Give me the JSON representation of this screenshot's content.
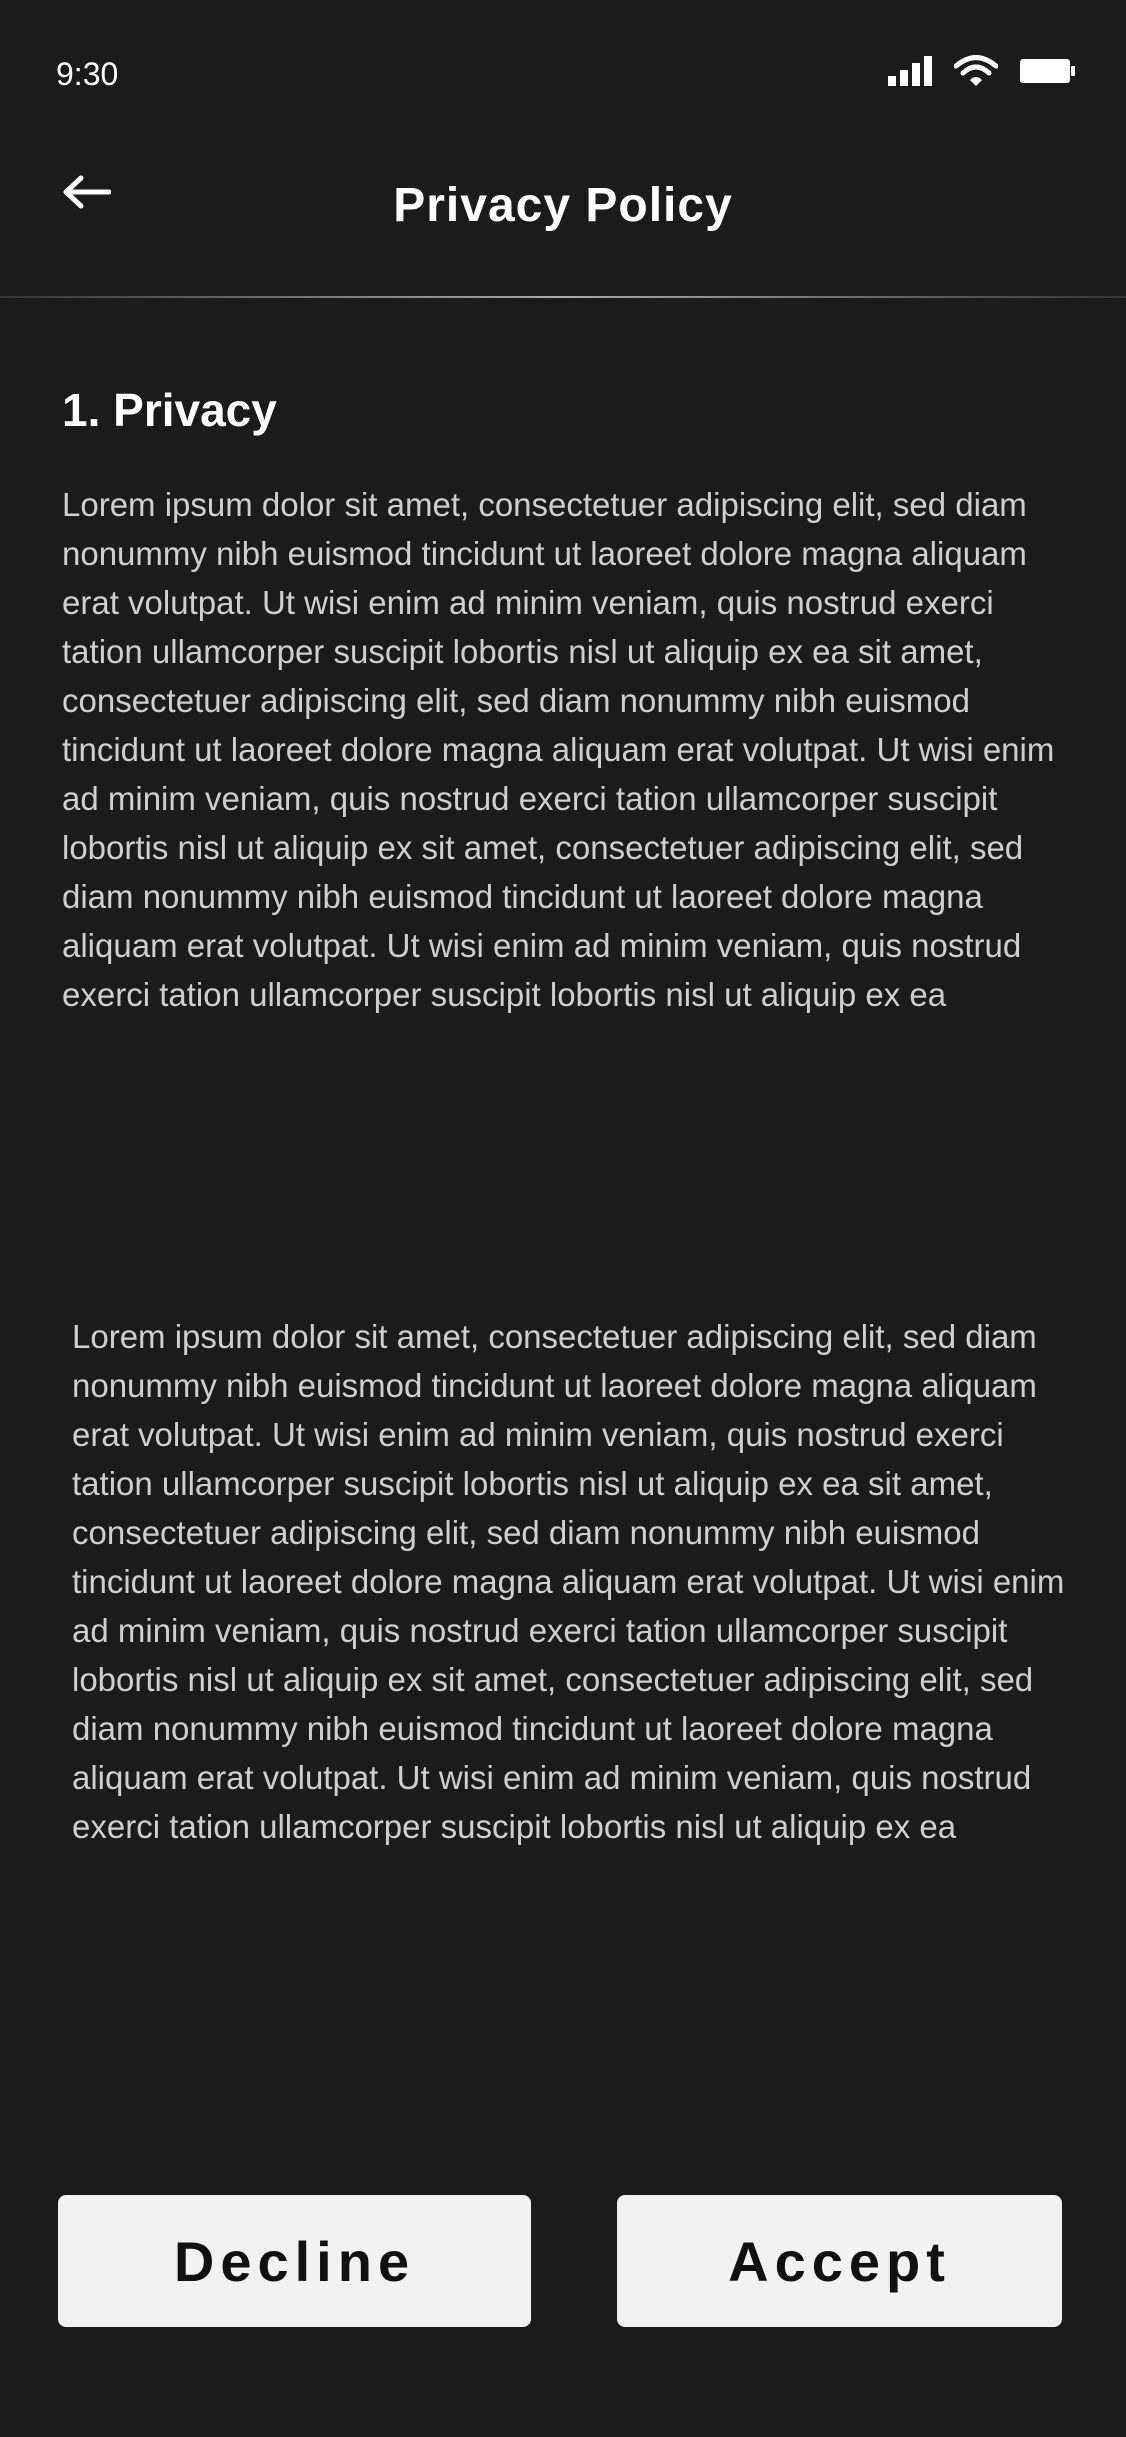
{
  "status_bar": {
    "time": "9:30",
    "icons": [
      "signal-icon",
      "wifi-icon",
      "battery-icon"
    ]
  },
  "header": {
    "back_icon": "arrow-left-icon",
    "title": "Privacy Policy"
  },
  "content": {
    "section_heading": "1. Privacy",
    "paragraphs": [
      "Lorem ipsum dolor sit amet, consectetuer adipiscing elit, sed diam nonummy nibh euismod tincidunt ut laoreet dolore magna aliquam erat volutpat. Ut wisi enim ad minim veniam, quis nostrud exerci tation ullamcorper suscipit lobortis nisl ut aliquip ex ea sit amet, consectetuer adipiscing elit, sed diam nonummy nibh euismod tincidunt ut laoreet dolore magna aliquam erat volutpat. Ut wisi enim ad minim veniam, quis nostrud exerci tation ullamcorper suscipit lobortis nisl ut aliquip ex sit amet, consectetuer adipiscing elit, sed diam nonummy nibh euismod tincidunt ut laoreet dolore magna aliquam erat volutpat. Ut wisi enim ad minim veniam, quis nostrud exerci tation ullamcorper suscipit lobortis nisl ut aliquip ex ea",
      "Lorem ipsum dolor sit amet, consectetuer adipiscing elit, sed diam nonummy nibh euismod tincidunt ut laoreet dolore magna aliquam erat volutpat. Ut wisi enim ad minim veniam, quis nostrud exerci tation ullamcorper suscipit lobortis nisl ut aliquip ex ea sit amet, consectetuer adipiscing elit, sed diam nonummy nibh euismod tincidunt ut laoreet dolore magna aliquam erat volutpat. Ut wisi enim ad minim veniam, quis nostrud exerci tation ullamcorper suscipit lobortis nisl ut aliquip ex sit amet, consectetuer adipiscing elit, sed diam nonummy nibh euismod tincidunt ut laoreet dolore magna aliquam erat volutpat. Ut wisi enim ad minim veniam, quis nostrud exerci tation ullamcorper suscipit lobortis nisl ut aliquip ex ea"
    ]
  },
  "actions": {
    "decline_label": "Decline",
    "accept_label": "Accept"
  },
  "colors": {
    "background": "#1b1b1c",
    "text_primary": "#ffffff",
    "text_body": "#cfcfcf",
    "button_background": "#f2f2f2",
    "button_text": "#111111"
  }
}
